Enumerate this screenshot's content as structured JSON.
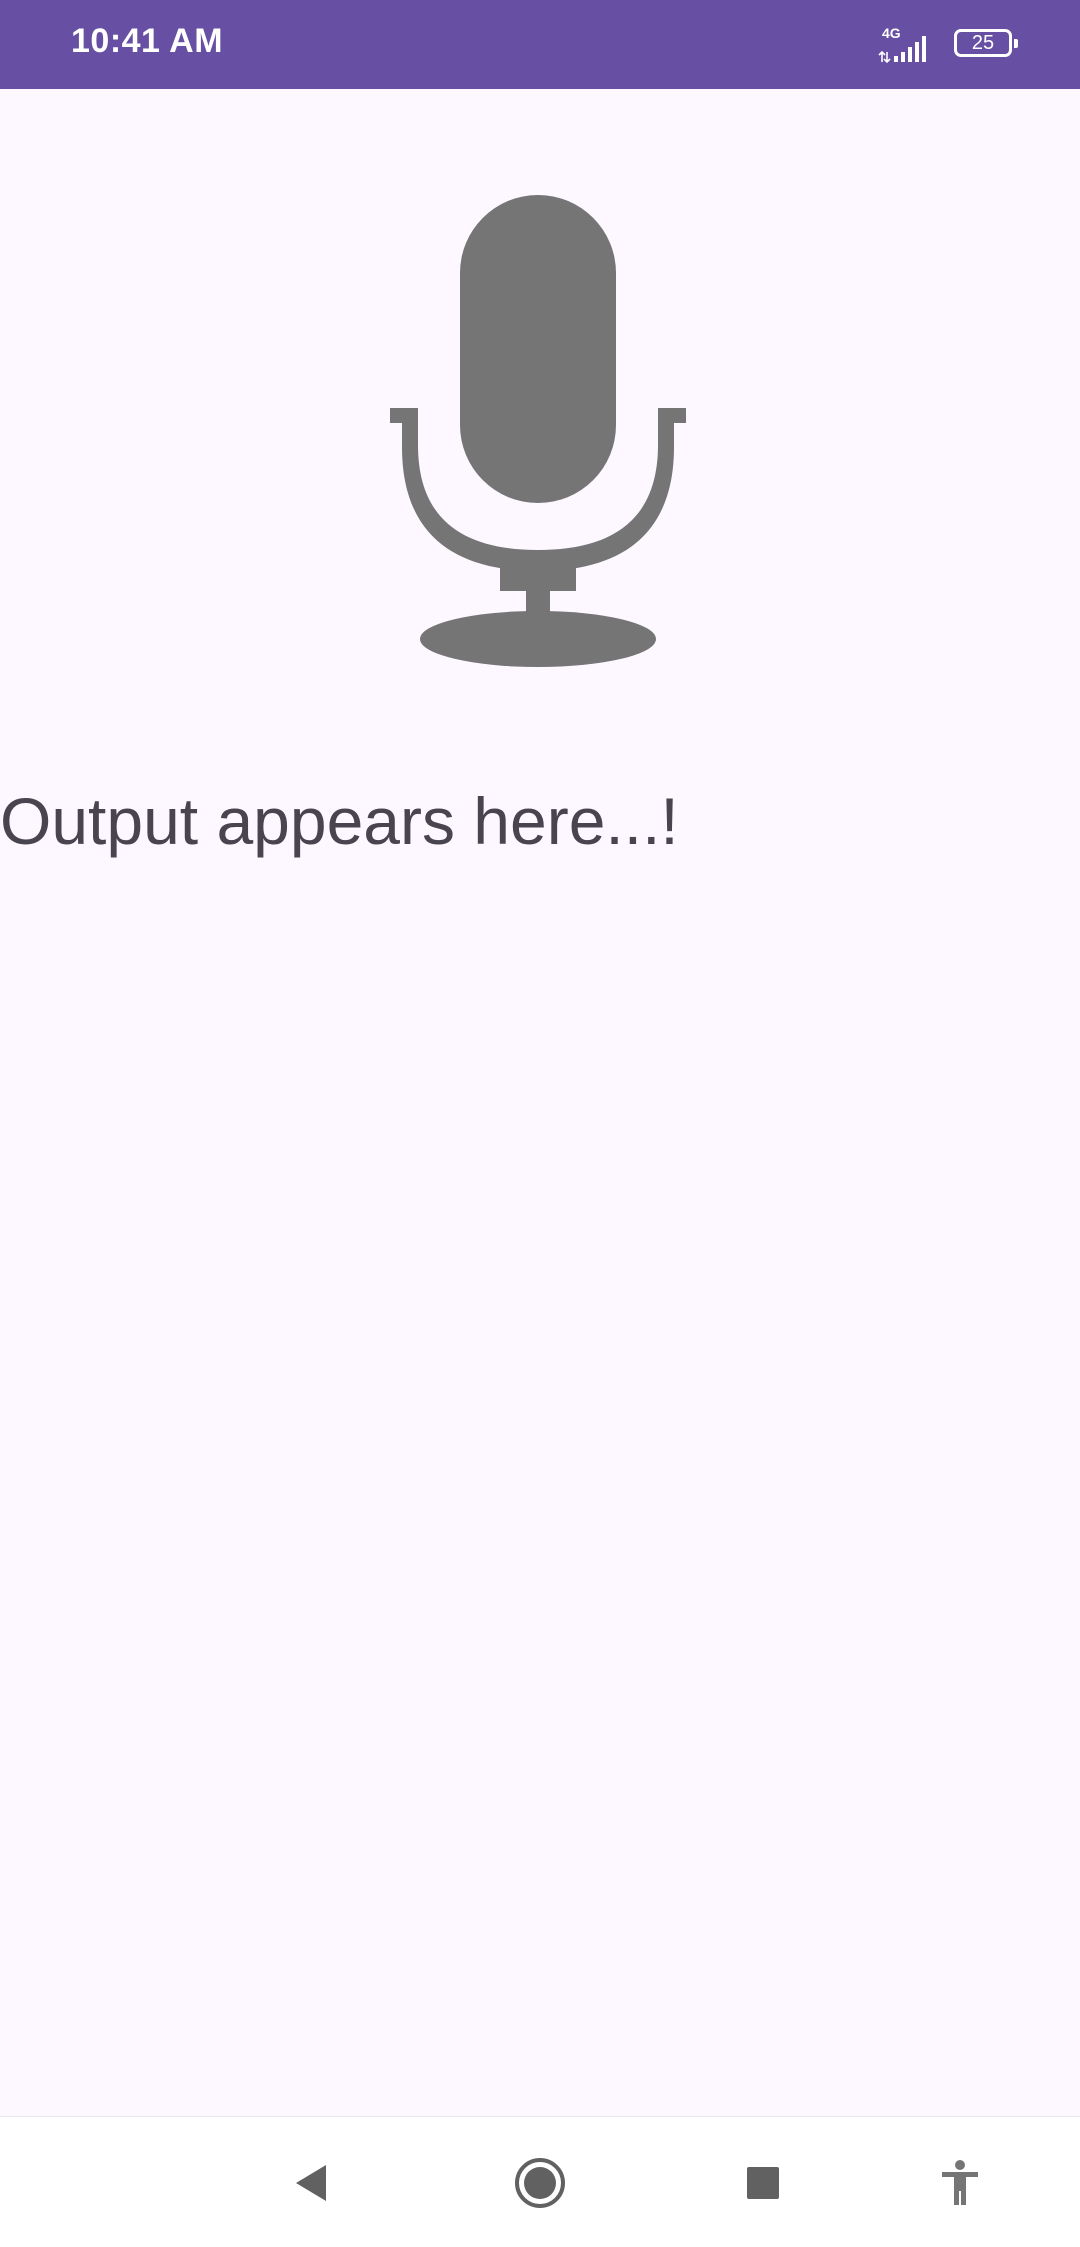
{
  "status_bar": {
    "time": "10:41 AM",
    "network_type": "4G",
    "battery_level": "25",
    "signal_icon": "cell-signal-icon",
    "background_color": "#6750A4"
  },
  "main": {
    "mic_icon": "microphone-icon",
    "mic_color": "#757575",
    "output_text": "Output appears here...!",
    "background_color": "#FDF7FF"
  },
  "nav_bar": {
    "back_icon": "back-triangle-icon",
    "home_icon": "home-circle-icon",
    "recents_icon": "recents-square-icon",
    "accessibility_icon": "accessibility-icon"
  }
}
